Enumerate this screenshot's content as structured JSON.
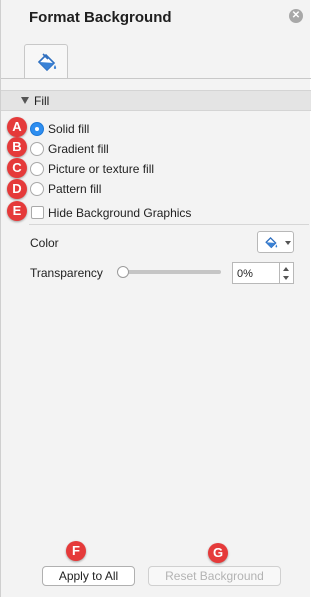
{
  "panel": {
    "title": "Format Background",
    "close_icon": "close-icon"
  },
  "tabs": [
    {
      "icon": "paint-bucket-icon"
    }
  ],
  "section": {
    "label": "Fill"
  },
  "fill_options": [
    {
      "label": "Solid fill",
      "type": "radio",
      "checked": true,
      "marker": "A"
    },
    {
      "label": "Gradient fill",
      "type": "radio",
      "checked": false,
      "marker": "B"
    },
    {
      "label": "Picture or texture fill",
      "type": "radio",
      "checked": false,
      "marker": "C"
    },
    {
      "label": "Pattern fill",
      "type": "radio",
      "checked": false,
      "marker": "D"
    },
    {
      "label": "Hide Background Graphics",
      "type": "checkbox",
      "checked": false,
      "marker": "E"
    }
  ],
  "color": {
    "label": "Color"
  },
  "transparency": {
    "label": "Transparency",
    "value": "0%",
    "level": 0
  },
  "buttons": {
    "apply_all": "Apply to All",
    "apply_marker": "F",
    "reset": "Reset Background",
    "reset_marker": "G"
  },
  "colors": {
    "accent": "#2e8ef0",
    "marker": "#e53a3a"
  }
}
